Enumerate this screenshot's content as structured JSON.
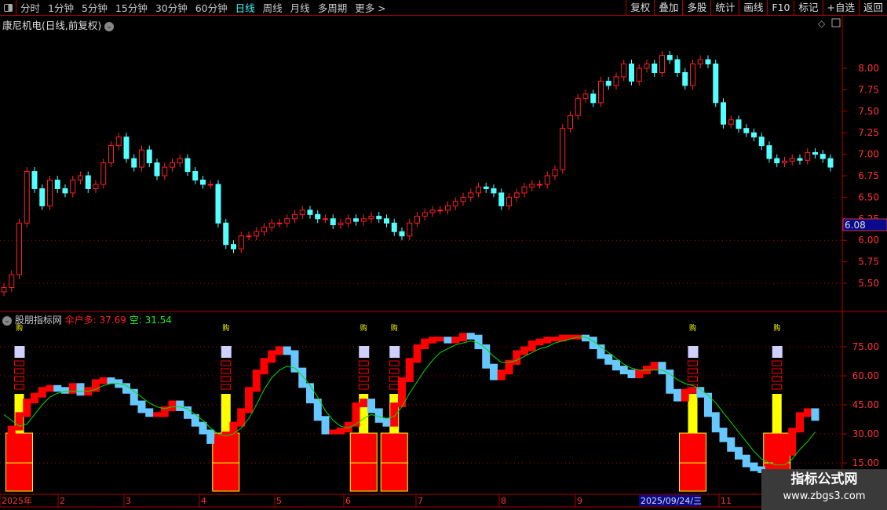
{
  "toolbar": {
    "periods": [
      "分时",
      "1分钟",
      "5分钟",
      "15分钟",
      "30分钟",
      "60分钟",
      "日线",
      "周线",
      "月线",
      "多周期",
      "更多 >"
    ],
    "active_period": "日线",
    "buttons": [
      "复权",
      "叠加",
      "多股",
      "统计",
      "画线",
      "F10",
      "标记",
      "+自选",
      "返回"
    ]
  },
  "chart_title": "康尼机电(日线,前复权)",
  "price_axis": {
    "labels": [
      "8.00",
      "7.75",
      "7.50",
      "7.25",
      "7.00",
      "6.75",
      "6.50",
      "6.25",
      "6.00",
      "5.75",
      "5.50"
    ],
    "current_price": "6.08",
    "ylim": [
      5.35,
      8.45
    ]
  },
  "indicator": {
    "name": "股朋指标网",
    "long_label": "伞户多: 37.69",
    "short_label": "空: 31.54",
    "axis_labels": [
      "75.00",
      "60.00",
      "45.00",
      "30.00",
      "15.00"
    ],
    "ylim": [
      5,
      95
    ],
    "signal_text": "购"
  },
  "date_axis": {
    "labels": [
      "2025年",
      "2",
      "3",
      "4",
      "5",
      "6",
      "7",
      "8",
      "9",
      "2025/09/24/三",
      "11"
    ]
  },
  "colors": {
    "up": "#ff2020",
    "down": "#54ffff",
    "long_up": "#ff0000",
    "long_down": "#66c8ff",
    "short_line": "#00dd00",
    "signal": "#ffff00",
    "accent": "#b00000"
  },
  "chart_data": {
    "type": "candlestick",
    "close": [
      5.45,
      5.6,
      6.2,
      6.8,
      6.6,
      6.4,
      6.7,
      6.6,
      6.55,
      6.7,
      6.75,
      6.6,
      6.65,
      6.9,
      7.1,
      7.2,
      6.95,
      6.85,
      7.05,
      6.9,
      6.75,
      6.85,
      6.9,
      6.95,
      6.8,
      6.7,
      6.65,
      6.65,
      6.2,
      5.95,
      5.9,
      6.05,
      6.05,
      6.1,
      6.15,
      6.2,
      6.2,
      6.25,
      6.3,
      6.35,
      6.3,
      6.25,
      6.25,
      6.18,
      6.2,
      6.25,
      6.22,
      6.25,
      6.28,
      6.25,
      6.2,
      6.1,
      6.05,
      6.2,
      6.28,
      6.32,
      6.35,
      6.35,
      6.4,
      6.45,
      6.5,
      6.55,
      6.62,
      6.6,
      6.55,
      6.4,
      6.5,
      6.55,
      6.62,
      6.65,
      6.65,
      6.75,
      6.82,
      7.3,
      7.45,
      7.65,
      7.7,
      7.6,
      7.85,
      7.8,
      7.9,
      8.05,
      7.85,
      8.0,
      8.05,
      7.95,
      8.15,
      8.1,
      7.95,
      7.8,
      8.05,
      8.1,
      8.05,
      7.6,
      7.35,
      7.4,
      7.3,
      7.25,
      7.2,
      7.1,
      6.95,
      6.9,
      6.92,
      6.95,
      6.93,
      7.02,
      7.0,
      6.95,
      6.85
    ],
    "long": [
      28,
      33,
      40,
      47,
      50,
      53,
      54,
      53,
      52,
      55,
      51,
      53,
      57,
      58,
      57,
      55,
      52,
      46,
      42,
      40,
      40,
      43,
      46,
      43,
      39,
      35,
      31,
      26,
      27,
      30,
      35,
      42,
      53,
      62,
      68,
      72,
      74,
      72,
      63,
      55,
      47,
      38,
      31,
      31,
      32,
      35,
      45,
      47,
      42,
      37,
      35,
      45,
      58,
      68,
      75,
      78,
      79,
      79,
      78,
      79,
      81,
      80,
      75,
      65,
      59,
      62,
      67,
      72,
      74,
      77,
      78,
      79,
      79,
      80,
      80,
      80,
      79,
      75,
      70,
      67,
      64,
      62,
      60,
      62,
      64,
      66,
      62,
      52,
      48,
      52,
      53,
      50,
      40,
      32,
      27,
      22,
      18,
      14,
      12,
      11,
      12,
      15,
      20,
      32,
      40,
      42,
      38
    ],
    "short": [
      40,
      37,
      34,
      35,
      40,
      45,
      49,
      51,
      52,
      52,
      52,
      52,
      53,
      55,
      56,
      56,
      55,
      52,
      49,
      46,
      44,
      43,
      44,
      44,
      43,
      40,
      37,
      33,
      30,
      29,
      30,
      33,
      38,
      45,
      53,
      59,
      63,
      65,
      64,
      60,
      55,
      49,
      42,
      37,
      34,
      33,
      35,
      38,
      40,
      39,
      38,
      39,
      44,
      51,
      57,
      63,
      68,
      72,
      74,
      76,
      77,
      78,
      77,
      74,
      70,
      67,
      67,
      68,
      70,
      72,
      74,
      75,
      77,
      78,
      79,
      80,
      80,
      78,
      75,
      72,
      69,
      66,
      64,
      63,
      63,
      63,
      63,
      61,
      58,
      56,
      55,
      53,
      50,
      46,
      41,
      36,
      31,
      26,
      21,
      17,
      15,
      14,
      14,
      17,
      22,
      26,
      31
    ],
    "signals": [
      2,
      29,
      47,
      51,
      90,
      101
    ]
  }
}
